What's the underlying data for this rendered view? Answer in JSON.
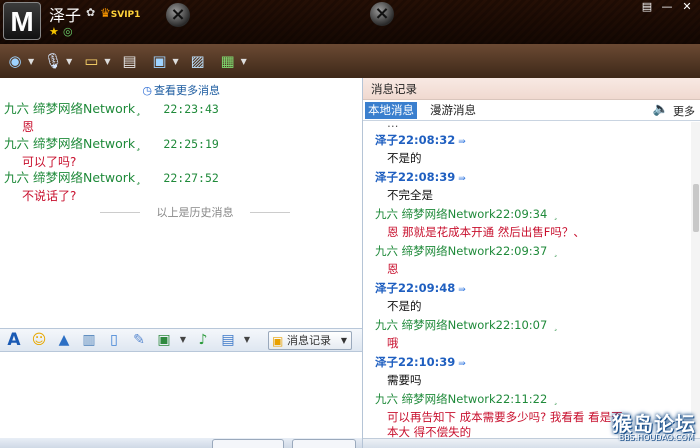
{
  "titlebar": {
    "logo_text": "M",
    "nickname": "泽子",
    "svip_label": "SVIP1",
    "icons": [
      "status-icon",
      "crown-icon",
      "star-icon",
      "qzone-icon",
      "screw-icon",
      "skin-icon",
      "minimize-icon",
      "close-icon"
    ]
  },
  "toolbar": {
    "items": [
      "video-call-icon",
      "voice-call-icon",
      "file-transfer-icon",
      "screen-share-icon",
      "remote-assist-icon",
      "image-icon",
      "apps-grid-icon"
    ]
  },
  "left": {
    "more_history": "查看更多消息",
    "messages": [
      {
        "sender": "九六  缔梦网络Network¸",
        "time": "22:23:43",
        "text": "恩"
      },
      {
        "sender": "九六  缔梦网络Network¸",
        "time": "22:25:19",
        "text": "可以了吗?"
      },
      {
        "sender": "九六  缔梦网络Network¸",
        "time": "22:27:52",
        "text": "不说话了?"
      }
    ],
    "history_divider": "以上是历史消息"
  },
  "inputbar": {
    "icons": [
      "font-icon",
      "emoji-icon",
      "shake-icon",
      "gallery-icon",
      "voice-message-icon",
      "scribble-icon",
      "screenshot-icon",
      "music-icon",
      "send-image-icon"
    ],
    "record_button": "消息记录"
  },
  "right": {
    "title": "消息记录",
    "tab_local": "本地消息",
    "tab_roaming": "漫游消息",
    "more": "更多",
    "entries": [
      {
        "kind": "me",
        "text": "泽子22:08:32"
      },
      {
        "kind": "txt",
        "text": "不是的"
      },
      {
        "kind": "me",
        "text": "泽子22:08:39"
      },
      {
        "kind": "txt",
        "text": "不完全是"
      },
      {
        "kind": "other",
        "text": "九六  缔梦网络Network22:09:34"
      },
      {
        "kind": "txtred",
        "text": "恩    那就是花成本开通    然后出售F吗？、"
      },
      {
        "kind": "other",
        "text": "九六  缔梦网络Network22:09:37"
      },
      {
        "kind": "txtred",
        "text": "恩"
      },
      {
        "kind": "me",
        "text": "泽子22:09:48"
      },
      {
        "kind": "txt",
        "text": "不是的"
      },
      {
        "kind": "other",
        "text": "九六  缔梦网络Network22:10:07"
      },
      {
        "kind": "txtred",
        "text": "哦"
      },
      {
        "kind": "me",
        "text": "泽子22:10:39"
      },
      {
        "kind": "txt",
        "text": "需要吗"
      },
      {
        "kind": "other",
        "text": "九六  缔梦网络Network22:11:22"
      },
      {
        "kind": "txtred",
        "text": "可以再告知下  成本需要多少吗?   我看看    看是否"
      },
      {
        "kind": "txtred",
        "text": "本大    得不偿失的"
      }
    ]
  },
  "watermark": {
    "text": "猴岛论坛",
    "url": "BBS.HOUDAO.COM"
  },
  "colors": {
    "sender_green": "#1f8a3a",
    "message_red": "#c8102e",
    "self_blue": "#1f5fc0",
    "tab_active": "#3a7fce"
  }
}
